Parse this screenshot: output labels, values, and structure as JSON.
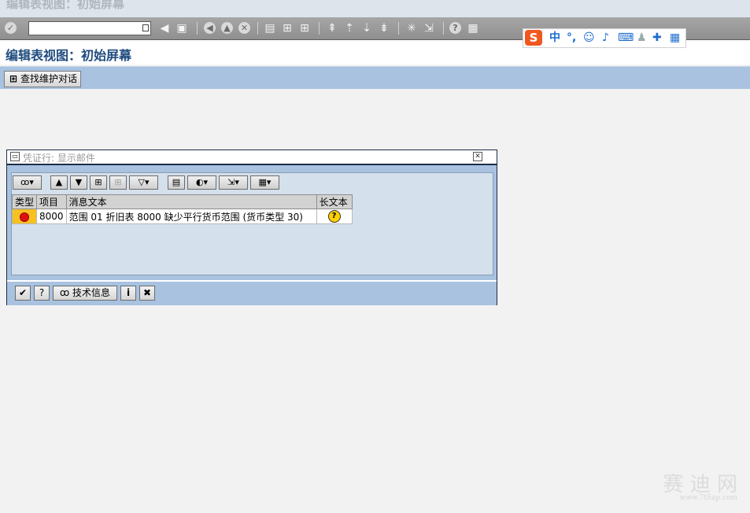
{
  "window": {
    "title": "编辑表视图：初始屏幕"
  },
  "toolbar": {
    "command_value": ""
  },
  "ime": {
    "logo": "S",
    "mode": "中",
    "punct": "°,"
  },
  "app": {
    "title": "编辑表视图：初始屏幕",
    "find_button": "查找维护对话"
  },
  "dialog": {
    "title": "凭证行: 显示邮件",
    "columns": [
      "类型",
      "项目",
      "消息文本",
      "长文本"
    ],
    "rows": [
      {
        "type": "error",
        "item": "8000",
        "text": "范围 01 折旧表 8000 缺少平行货币范围 (货币类型 30)",
        "longtext": "?"
      }
    ],
    "buttons": {
      "tech_info": "技术信息"
    }
  },
  "watermark": {
    "text": "赛 迪 网",
    "url": "www.7tSap.com"
  },
  "colors": {
    "accent": "#a8c2e0",
    "title": "#1f4b7f",
    "error": "#e01010"
  }
}
